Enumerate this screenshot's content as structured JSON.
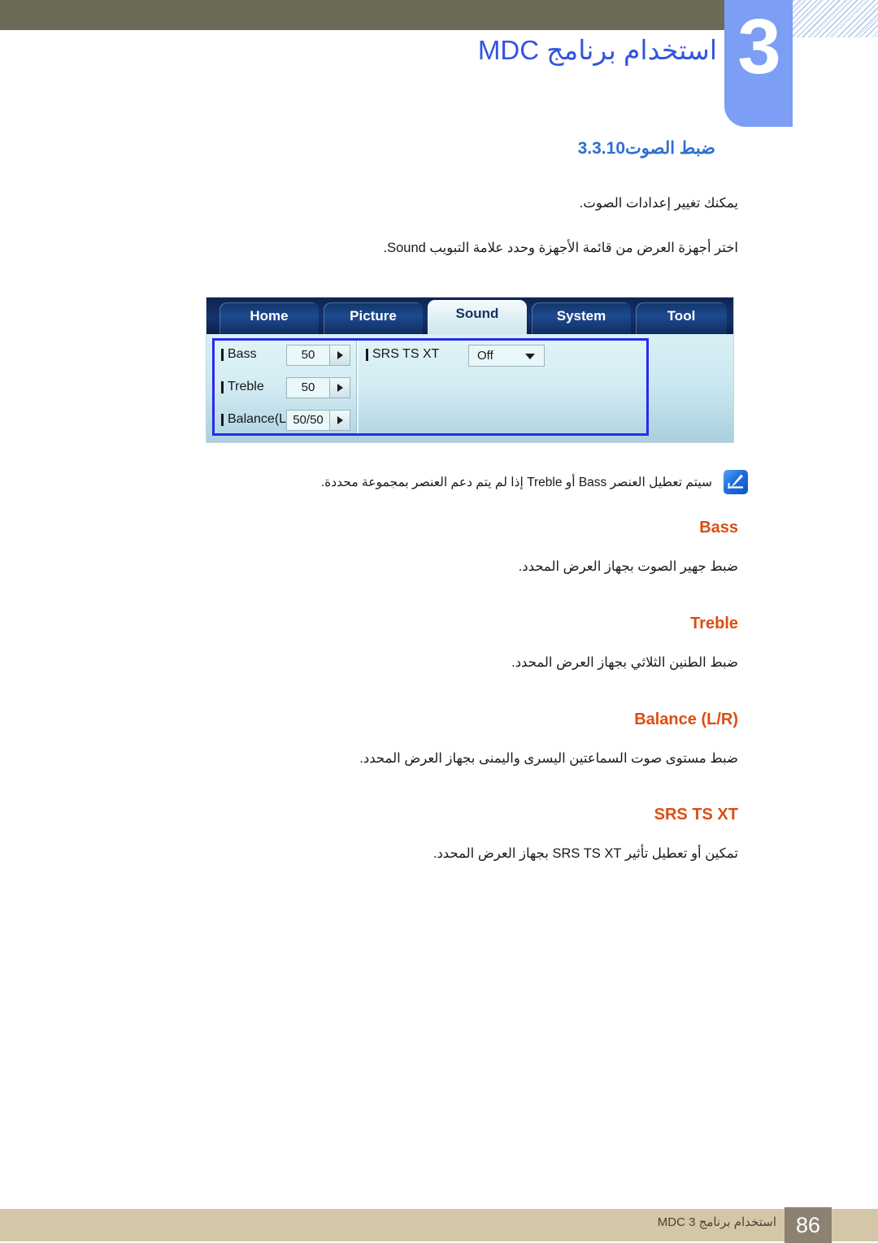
{
  "chapter": {
    "number": "3",
    "title": "استخدام برنامج MDC"
  },
  "section": {
    "number": "3.3.10",
    "title": "ضبط الصوت",
    "intro": "يمكنك تغيير إعدادات الصوت.",
    "instruction": "اختر أجهزة العرض من قائمة الأجهزة وحدد علامة التبويب Sound."
  },
  "mdc_screenshot": {
    "tabs": [
      {
        "label": "Home",
        "active": false
      },
      {
        "label": "Picture",
        "active": false
      },
      {
        "label": "Sound",
        "active": true
      },
      {
        "label": "System",
        "active": false
      },
      {
        "label": "Tool",
        "active": false
      }
    ],
    "left_panel": [
      {
        "label": "Bass",
        "value": "50",
        "control": "spinner"
      },
      {
        "label": "Treble",
        "value": "50",
        "control": "spinner"
      },
      {
        "label": "Balance(L/R)",
        "value": "50/50",
        "control": "spinner"
      }
    ],
    "right_panel": [
      {
        "label": "SRS TS XT",
        "value": "Off",
        "control": "dropdown"
      }
    ],
    "highlight_color": "#2a2ae8"
  },
  "note": {
    "icon": "note-pencil-icon",
    "text": "سيتم تعطيل العنصر Bass أو Treble إذا لم يتم دعم العنصر بمجموعة محددة."
  },
  "items": [
    {
      "heading": "Bass",
      "description": "ضبط جهير الصوت بجهاز العرض المحدد."
    },
    {
      "heading": "Treble",
      "description": "ضبط الطنين الثلاثي بجهاز العرض المحدد."
    },
    {
      "heading": "Balance (L/R)",
      "description": "ضبط مستوى صوت السماعتين اليسرى واليمنى بجهاز العرض المحدد."
    },
    {
      "heading": "SRS TS XT",
      "description": "تمكين أو تعطيل تأثير SRS TS XT بجهاز العرض المحدد."
    }
  ],
  "footer": {
    "page_number": "86",
    "text": "استخدام برنامج MDC 3"
  },
  "colors": {
    "olive_bar": "#6d6b57",
    "chapter_tab": "#7c9ef4",
    "chapter_title": "#3355dd",
    "section_heading": "#2f6fd0",
    "sub_heading": "#dd4d12",
    "footer_bar": "#d3c7a8",
    "footer_page_box": "#8d8271"
  }
}
